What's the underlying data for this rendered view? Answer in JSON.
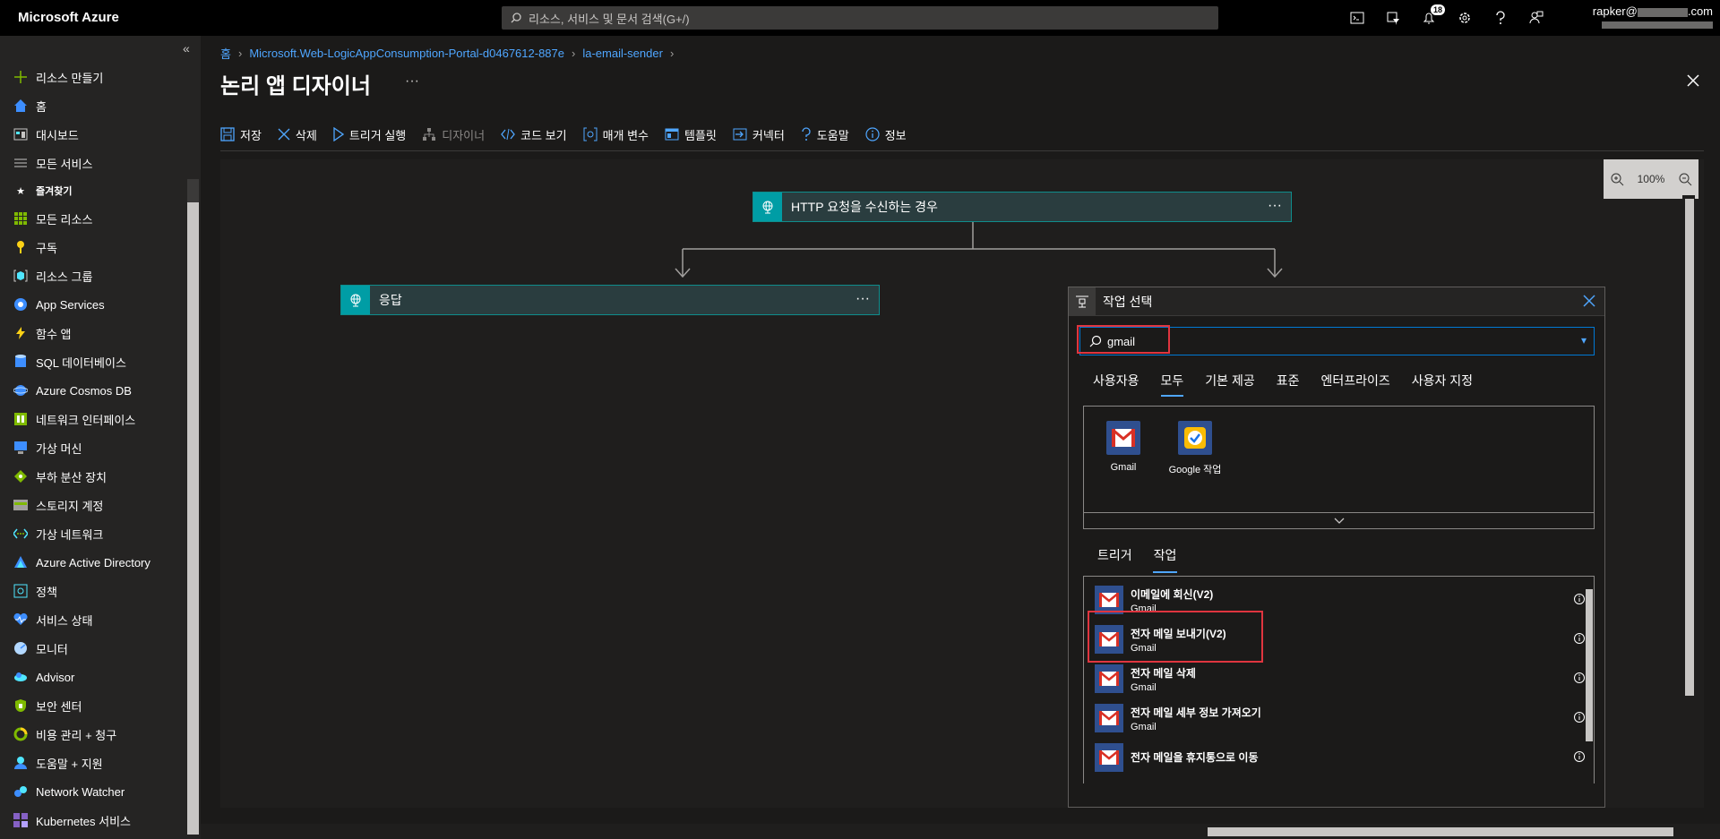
{
  "topbar": {
    "brand": "Microsoft Azure",
    "search_placeholder": "리소스, 서비스 및 문서 검색(G+/)",
    "notification_count": "18",
    "account_prefix": "rapker@",
    "account_suffix": ".com"
  },
  "sidebar": {
    "items": [
      {
        "label": "리소스 만들기",
        "icon": "plus-icon"
      },
      {
        "label": "홈",
        "icon": "home-icon"
      },
      {
        "label": "대시보드",
        "icon": "dashboard-icon"
      },
      {
        "label": "모든 서비스",
        "icon": "list-icon"
      },
      {
        "label": "즐겨찾기",
        "icon": "star-icon"
      },
      {
        "label": "모든 리소스",
        "icon": "grid-icon"
      },
      {
        "label": "구독",
        "icon": "key-icon"
      },
      {
        "label": "리소스 그룹",
        "icon": "resource-group-icon"
      },
      {
        "label": "App Services",
        "icon": "app-services-icon"
      },
      {
        "label": "함수 앱",
        "icon": "function-icon"
      },
      {
        "label": "SQL 데이터베이스",
        "icon": "sql-icon"
      },
      {
        "label": "Azure Cosmos DB",
        "icon": "cosmos-icon"
      },
      {
        "label": "네트워크 인터페이스",
        "icon": "network-interface-icon"
      },
      {
        "label": "가상 머신",
        "icon": "vm-icon"
      },
      {
        "label": "부하 분산 장치",
        "icon": "load-balancer-icon"
      },
      {
        "label": "스토리지 계정",
        "icon": "storage-icon"
      },
      {
        "label": "가상 네트워크",
        "icon": "vnet-icon"
      },
      {
        "label": "Azure Active Directory",
        "icon": "aad-icon"
      },
      {
        "label": "정책",
        "icon": "policy-icon"
      },
      {
        "label": "서비스 상태",
        "icon": "health-icon"
      },
      {
        "label": "모니터",
        "icon": "monitor-icon"
      },
      {
        "label": "Advisor",
        "icon": "advisor-icon"
      },
      {
        "label": "보안 센터",
        "icon": "security-icon"
      },
      {
        "label": "비용 관리 + 청구",
        "icon": "cost-icon"
      },
      {
        "label": "도움말 + 지원",
        "icon": "support-icon"
      },
      {
        "label": "Network Watcher",
        "icon": "network-watcher-icon"
      },
      {
        "label": "Kubernetes 서비스",
        "icon": "kubernetes-icon"
      }
    ]
  },
  "breadcrumb": {
    "home": "홈",
    "resource_group": "Microsoft.Web-LogicAppConsumption-Portal-d0467612-887e",
    "app": "la-email-sender"
  },
  "page": {
    "title": "논리 앱 디자이너",
    "more": "···"
  },
  "toolbar": {
    "save": "저장",
    "delete": "삭제",
    "run_trigger": "트리거 실행",
    "designer": "디자이너",
    "code_view": "코드 보기",
    "parameters": "매개 변수",
    "templates": "템플릿",
    "connectors": "커넥터",
    "help": "도움말",
    "info": "정보"
  },
  "canvas": {
    "zoom": "100%",
    "trigger_card": "HTTP 요청을 수신하는 경우",
    "response_card": "응답",
    "more": "···"
  },
  "picker": {
    "title": "작업 선택",
    "search_value": "gmail",
    "filter_tabs": [
      "사용자용",
      "모두",
      "기본 제공",
      "표준",
      "엔터프라이즈",
      "사용자 지정"
    ],
    "active_filter": "모두",
    "connectors": [
      {
        "label": "Gmail"
      },
      {
        "label": "Google 작업"
      }
    ],
    "action_tabs": [
      "트리거",
      "작업"
    ],
    "active_action_tab": "작업",
    "actions": [
      {
        "name": "이메일에 회신(V2)",
        "connector": "Gmail"
      },
      {
        "name": "전자 메일 보내기(V2)",
        "connector": "Gmail"
      },
      {
        "name": "전자 메일 삭제",
        "connector": "Gmail"
      },
      {
        "name": "전자 메일 세부 정보 가져오기",
        "connector": "Gmail"
      },
      {
        "name": "전자 메일을 휴지통으로 이동",
        "connector": ""
      }
    ]
  },
  "colors": {
    "accent": "#0078d4",
    "link": "#4fa6ff",
    "highlight": "#e0353f",
    "flow_card": "#2a3d3f",
    "flow_icon": "#009da5"
  }
}
